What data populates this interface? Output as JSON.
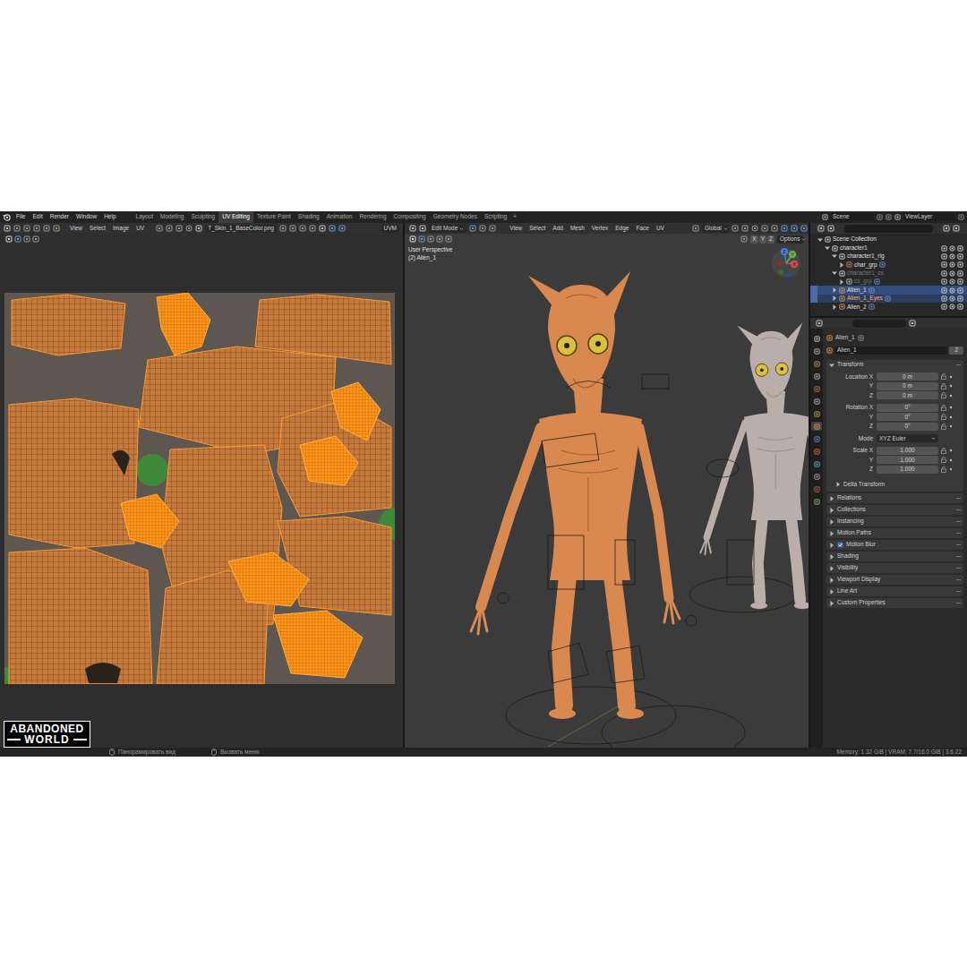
{
  "menu": [
    "File",
    "Edit",
    "Render",
    "Window",
    "Help"
  ],
  "workspaces": [
    {
      "label": "Layout",
      "selected": false
    },
    {
      "label": "Modeling",
      "selected": false
    },
    {
      "label": "Sculpting",
      "selected": false
    },
    {
      "label": "UV Editing",
      "selected": true
    },
    {
      "label": "Texture Paint",
      "selected": false
    },
    {
      "label": "Shading",
      "selected": false
    },
    {
      "label": "Animation",
      "selected": false
    },
    {
      "label": "Rendering",
      "selected": false
    },
    {
      "label": "Compositing",
      "selected": false
    },
    {
      "label": "Geometry Nodes",
      "selected": false
    },
    {
      "label": "Scripting",
      "selected": false
    }
  ],
  "workspace_add": "+",
  "scene": "Scene",
  "view_layer": "ViewLayer",
  "uv_editor": {
    "menus": [
      "View",
      "Select",
      "Image",
      "UV"
    ],
    "image": "T_Skin_1_BaseColor.png",
    "uv_map": "UVM"
  },
  "viewport": {
    "mode": "Edit Mode",
    "menus": [
      "View",
      "Select",
      "Add",
      "Mesh",
      "Vertex",
      "Edge",
      "Face",
      "UV"
    ],
    "orientation": "Global",
    "axes": [
      "X",
      "Y",
      "Z"
    ],
    "options": "Options",
    "view_name": "User Perspective",
    "object_label": "(2) Alien_1",
    "gizmo": [
      "X",
      "Y",
      "Z"
    ]
  },
  "outliner": {
    "rows": [
      {
        "label": "Scene Collection",
        "depth": 0,
        "expanded": true,
        "selected": false,
        "active": false,
        "dimmed": false,
        "kind": "scene"
      },
      {
        "label": "character1",
        "depth": 1,
        "expanded": true,
        "selected": false,
        "active": false,
        "dimmed": false,
        "kind": "collection"
      },
      {
        "label": "character1_rig",
        "depth": 2,
        "expanded": true,
        "selected": false,
        "active": false,
        "dimmed": false,
        "kind": "collection"
      },
      {
        "label": "char_grp",
        "depth": 3,
        "expanded": false,
        "selected": false,
        "active": false,
        "dimmed": false,
        "kind": "armature"
      },
      {
        "label": "character1_cs",
        "depth": 2,
        "expanded": true,
        "selected": false,
        "active": false,
        "dimmed": true,
        "kind": "collection"
      },
      {
        "label": "cs_grp",
        "depth": 3,
        "expanded": false,
        "selected": false,
        "active": false,
        "dimmed": true,
        "kind": "empty"
      },
      {
        "label": "Alien_1",
        "depth": 2,
        "expanded": false,
        "selected": true,
        "active": true,
        "dimmed": false,
        "kind": "mesh"
      },
      {
        "label": "Alien_1_Eyes",
        "depth": 2,
        "expanded": false,
        "selected": true,
        "active": false,
        "dimmed": false,
        "kind": "mesh"
      },
      {
        "label": "Alien_2",
        "depth": 2,
        "expanded": false,
        "selected": false,
        "active": false,
        "dimmed": false,
        "kind": "mesh"
      }
    ]
  },
  "property_tabs": [
    {
      "selected": false
    },
    {
      "selected": false
    },
    {
      "selected": false
    },
    {
      "selected": false
    },
    {
      "selected": false
    },
    {
      "selected": false
    },
    {
      "selected": false
    },
    {
      "selected": true
    },
    {
      "selected": false
    },
    {
      "selected": false
    },
    {
      "selected": false
    },
    {
      "selected": false
    },
    {
      "selected": false
    },
    {
      "selected": false
    }
  ],
  "properties": {
    "object": "Alien_1",
    "data_field": "Alien_1",
    "users": "2",
    "transform": {
      "title": "Transform",
      "expanded": true,
      "groups": [
        [
          {
            "label": "Location X",
            "value": "0 m",
            "kind": "number"
          },
          {
            "label": "Y",
            "value": "0 m",
            "kind": "number"
          },
          {
            "label": "Z",
            "value": "0 m",
            "kind": "number"
          }
        ],
        [
          {
            "label": "Rotation X",
            "value": "0°",
            "kind": "number"
          },
          {
            "label": "Y",
            "value": "0°",
            "kind": "number"
          },
          {
            "label": "Z",
            "value": "0°",
            "kind": "number"
          }
        ],
        [
          {
            "label": "Mode",
            "value": "XYZ Euler",
            "kind": "dropdown"
          }
        ],
        [
          {
            "label": "Scale X",
            "value": "1.000",
            "kind": "number"
          },
          {
            "label": "Y",
            "value": "1.000",
            "kind": "number"
          },
          {
            "label": "Z",
            "value": "1.000",
            "kind": "number"
          }
        ]
      ],
      "subpanels": [
        {
          "title": "Delta Transform",
          "expanded": false
        }
      ]
    },
    "panels": [
      {
        "title": "Relations",
        "expanded": false,
        "kind": "plain",
        "checked": false
      },
      {
        "title": "Collections",
        "expanded": false,
        "kind": "plain",
        "checked": false
      },
      {
        "title": "Instancing",
        "expanded": false,
        "kind": "plain",
        "checked": false
      },
      {
        "title": "Motion Paths",
        "expanded": false,
        "kind": "plain",
        "checked": false
      },
      {
        "title": "Motion Blur",
        "expanded": false,
        "kind": "checkbox",
        "checked": true
      },
      {
        "title": "Shading",
        "expanded": false,
        "kind": "plain",
        "checked": false
      },
      {
        "title": "Visibility",
        "expanded": false,
        "kind": "plain",
        "checked": false
      },
      {
        "title": "Viewport Display",
        "expanded": false,
        "kind": "plain",
        "checked": false
      },
      {
        "title": "Line Art",
        "expanded": false,
        "kind": "plain",
        "checked": false
      },
      {
        "title": "Custom Properties",
        "expanded": false,
        "kind": "plain",
        "checked": false
      }
    ]
  },
  "status_bar": {
    "hints": [
      "Панорамировать вид",
      "Вызвать меню"
    ],
    "info": "Memory: 1.32 GiB | VRAM: 7.7/16.0 GiB | 3.6.22"
  },
  "watermark": {
    "line1": "ABANDONED",
    "line2": "WORLD"
  }
}
